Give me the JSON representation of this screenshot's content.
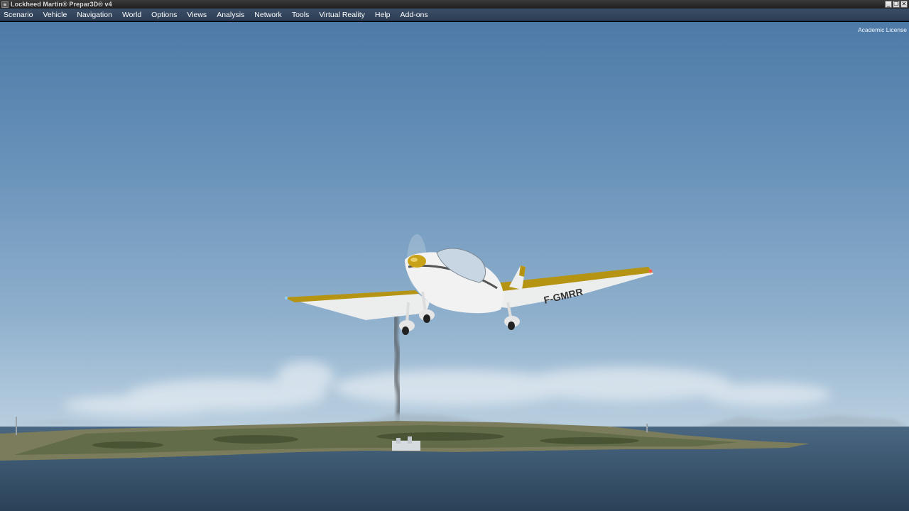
{
  "window": {
    "title": "Lockheed Martin® Prepar3D® v4",
    "controls": [
      "_",
      "❐",
      "✕"
    ]
  },
  "menu": {
    "items": [
      {
        "label": "Scenario"
      },
      {
        "label": "Vehicle"
      },
      {
        "label": "Navigation"
      },
      {
        "label": "World"
      },
      {
        "label": "Options"
      },
      {
        "label": "Views"
      },
      {
        "label": "Analysis"
      },
      {
        "label": "Network"
      },
      {
        "label": "Tools"
      },
      {
        "label": "Virtual Reality"
      },
      {
        "label": "Help"
      },
      {
        "label": "Add-ons"
      }
    ]
  },
  "scene": {
    "license_text": "Academic License",
    "aircraft_registration": "F-GMRR",
    "colors": {
      "sky_top": "#4d7aa8",
      "sky_horizon": "#c9d9e6",
      "sea": "#34506a",
      "aircraft_body": "#f2f2f2",
      "aircraft_trim": "#b59413"
    }
  }
}
